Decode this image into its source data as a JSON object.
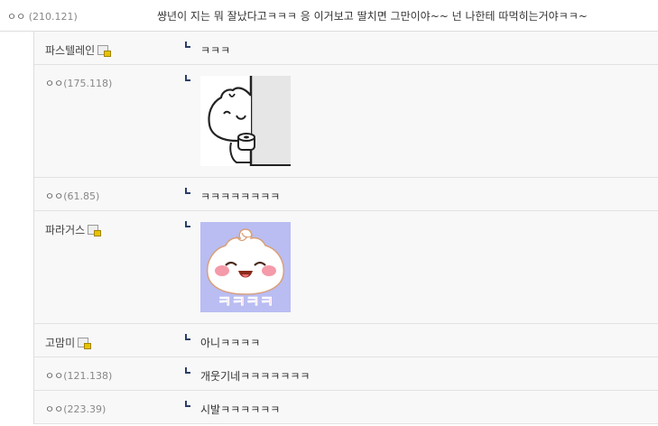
{
  "comment": {
    "nick": "ㅇㅇ",
    "ip": "(210.121)",
    "text": "썅년이 지는 뭐 잘났다고ㅋㅋㅋ 응 이거보고 딸치면 그만이야~~ 넌 나한테 따먹히는거야ㅋㅋ~"
  },
  "replies": [
    {
      "nick": "파스텔레인",
      "ip": "",
      "text": "ㅋㅋㅋ",
      "type": "text"
    },
    {
      "nick": "ㅇㅇ",
      "ip": "(175.118)",
      "text": "",
      "type": "sticker",
      "sticker": "peeking-dumpling-sticker"
    },
    {
      "nick": "ㅇㅇ",
      "ip": "(61.85)",
      "text": "ㅋㅋㅋㅋㅋㅋㅋㅋ",
      "type": "text"
    },
    {
      "nick": "파라거스",
      "ip": "",
      "text": "",
      "type": "sticker",
      "sticker": "laughing-dumpling-sticker",
      "sticker_caption": "ㅋㅋㅋㅋ"
    },
    {
      "nick": "고맘미",
      "ip": "",
      "text": "아니ㅋㅋㅋㅋ",
      "type": "text"
    },
    {
      "nick": "ㅇㅇ",
      "ip": "(121.138)",
      "text": "개웃기네ㅋㅋㅋㅋㅋㅋㅋ",
      "type": "text"
    },
    {
      "nick": "ㅇㅇ",
      "ip": "(223.39)",
      "text": "시발ㅋㅋㅋㅋㅋㅋ",
      "type": "text"
    }
  ],
  "colors": {
    "reply_bg": "#f8f8f8",
    "arrow": "#2b3f6b",
    "sticker_bg": "#b9bdf2",
    "sticker_text": "#e0306e"
  }
}
